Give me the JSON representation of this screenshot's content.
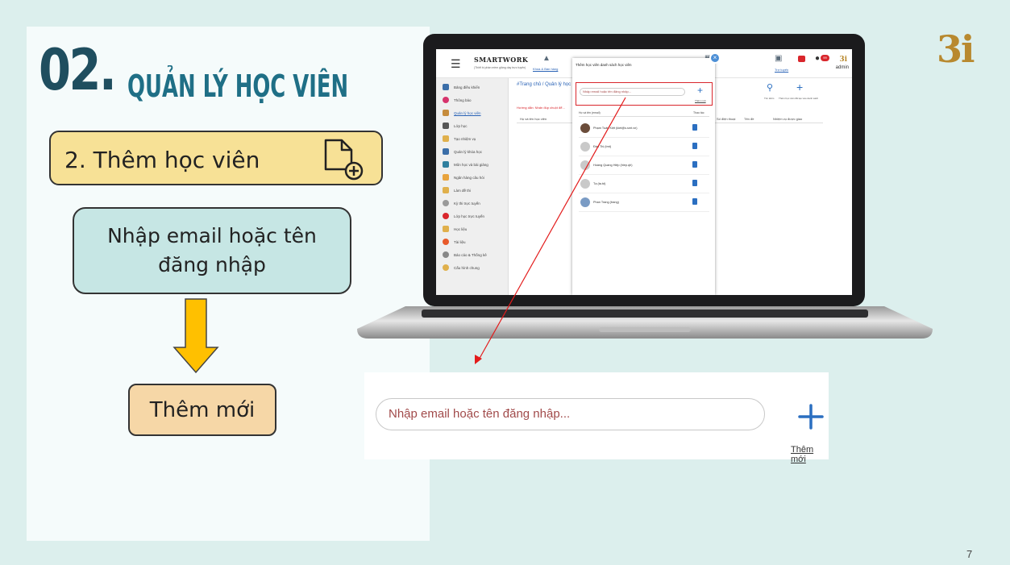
{
  "slide": {
    "number_prefix": "02.",
    "title": "QUẢN LÝ HỌC VIÊN",
    "step_label": "2. Thêm học viên",
    "input_hint": "Nhập email hoặc tên đăng nhập",
    "add_button": "Thêm mới",
    "logo": "3i",
    "page_number": "7"
  },
  "app": {
    "brand": "SMARTWORK",
    "brand_sub": "(Thiết bị phần mềm giảng dạy trực tuyến)",
    "header_link_1": "Khóa & Bán hàng",
    "admin_label": "admin",
    "brand_3i": "3i",
    "notif_count": "99",
    "header_link_2": "Trợ tuyến",
    "sidebar_items": [
      "Bảng điều khiển",
      "Thông báo",
      "Quản lý học viên",
      "Lớp học",
      "Tạo nhiệm vụ",
      "Quản lý khóa học",
      "Môn học và bài giảng",
      "Ngân hàng câu hỏi",
      "Làm đề thi",
      "Kỳ thi trực tuyến",
      "Lớp học trực tuyến",
      "Học liệu",
      "Tài liệu",
      "Báo cáo & Thống kê",
      "Cấu hình chung"
    ],
    "breadcrumb": "#Trang chủ / Quản lý học viên",
    "hint": "Hướng dẫn: Nhấn đúp chuột để...",
    "table_headers": [
      "Họ và tên học viên",
      "Số điện thoại",
      "Tên đề",
      "Nhiệm vụ được giao"
    ],
    "tool_search_label": "Tìm kiếm",
    "tool_add_label": "Thêm học viên đã tạo vào danh sách"
  },
  "modal": {
    "title": "Thêm học viên danh sách học viên",
    "input_placeholder": "Nhập email hoặc tên đăng nhập...",
    "add_label": "Thêm mới",
    "col_name": "Họ và tên (email)",
    "col_action": "Thao tác",
    "rows": [
      {
        "name": "Phạm Tuấn Kiệt (kiet@s.smt.vn)"
      },
      {
        "name": "Đào Thị (tmt)"
      },
      {
        "name": "Hoàng Quang Hiệp (hiep.qh)"
      },
      {
        "name": "Tạ (ta.td)"
      },
      {
        "name": "Phan Trang (trang)"
      }
    ]
  },
  "zoom": {
    "input_placeholder": "Nhập email hoặc tên đăng nhập...",
    "add_label": "Thêm mới"
  },
  "colors": {
    "title_dark": "#1f4e5f",
    "title_teal": "#1f6f86",
    "step_fill": "#f7e196",
    "input_fill": "#c6e6e4",
    "add_fill": "#f6d7a7",
    "arrow_fill": "#ffc000",
    "accent_blue": "#2b6fc1",
    "accent_red": "#d9262c"
  },
  "icons": {
    "step_icon": "add-document-icon",
    "arrow_icon": "arrow-down-icon",
    "plus_icon": "plus-icon"
  }
}
